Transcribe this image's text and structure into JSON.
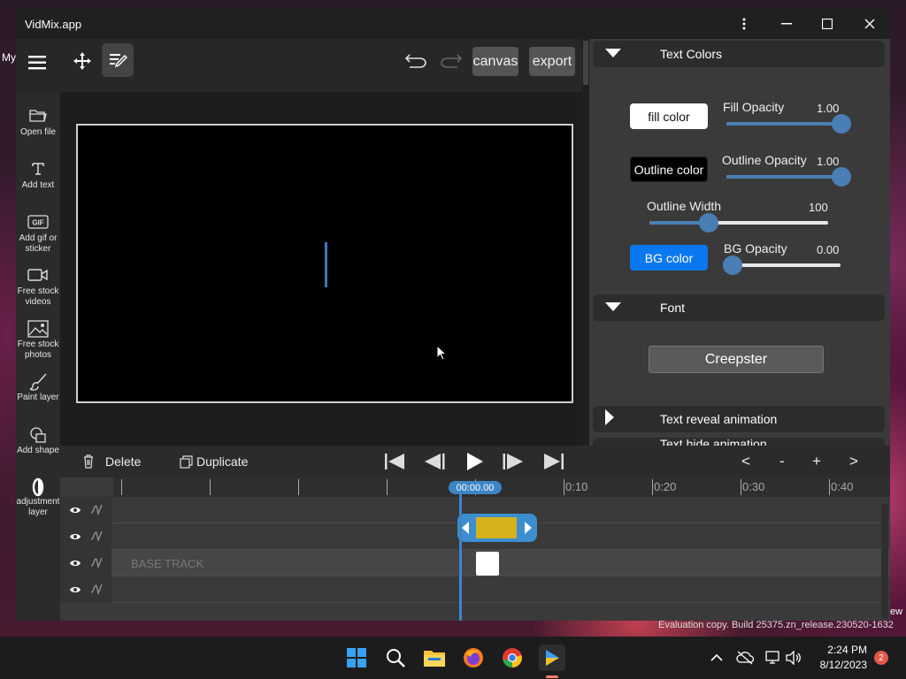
{
  "window": {
    "title": "VidMix.app"
  },
  "toolbar": {
    "canvas_label": "canvas",
    "export_label": "export"
  },
  "sidebar": {
    "items": [
      {
        "label": "Open file"
      },
      {
        "label": "Add text"
      },
      {
        "label": "Add gif or sticker"
      },
      {
        "label": "Free stock videos"
      },
      {
        "label": "Free stock photos"
      },
      {
        "label": "Paint layer"
      },
      {
        "label": "Add shape"
      },
      {
        "label": "adjustment layer"
      }
    ]
  },
  "panel": {
    "text_colors_title": "Text Colors",
    "fill_color_label": "fill color",
    "fill_opacity_label": "Fill Opacity",
    "fill_opacity_value": "1.00",
    "fill_opacity_level": 1.0,
    "outline_color_label": "Outline color",
    "outline_opacity_label": "Outline Opacity",
    "outline_opacity_value": "1.00",
    "outline_opacity_level": 1.0,
    "outline_width_label": "Outline Width",
    "outline_width_value": "100",
    "outline_width_level": 0.33,
    "bg_color_label": "BG color",
    "bg_opacity_label": "BG Opacity",
    "bg_opacity_value": "0.00",
    "bg_opacity_level": 0.0,
    "font_title": "Font",
    "font_value": "Creepster",
    "text_reveal_title": "Text reveal animation",
    "text_hide_title": "Text hide animation"
  },
  "controls": {
    "delete_label": "Delete",
    "duplicate_label": "Duplicate",
    "zoom_prev": "<",
    "zoom_minus": "-",
    "zoom_plus": "+",
    "zoom_next": ">"
  },
  "timeline": {
    "current_time": "00:00.00",
    "ticks": [
      "0:10",
      "0:20",
      "0:30",
      "0:40"
    ],
    "base_track_label": "BASE TRACK"
  },
  "taskbar": {
    "time": "2:24 PM",
    "date": "8/12/2023",
    "notifications": "2"
  },
  "watermark": "Evaluation copy. Build 25375.zn_release.230520-1632",
  "colors": {
    "accent": "#3d86c6",
    "bg_color_button": "#0a78f0",
    "clip": "#d6b21d"
  }
}
